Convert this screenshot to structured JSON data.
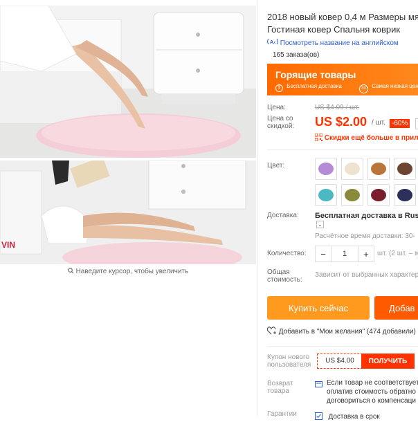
{
  "gallery": {
    "zoom_hint": "Наведите курсор, чтобы увеличить"
  },
  "product": {
    "title_line1": "2018 новый ковер 0,4 м Размеры мяг",
    "title_line2": "Гостиная ковер Спальня коврик",
    "translate_link": "Посмотреть название на английском",
    "orders": "165 заказа(ов)"
  },
  "hot_deals": {
    "title": "Горящие товары",
    "feature1": "Бесплатная доставка",
    "feature2": "Самая низкая цен",
    "badge1": "$",
    "badge2": "30"
  },
  "price": {
    "label": "Цена:",
    "old": "US $4.09 / шт.",
    "discount_label_line1": "Цена со",
    "discount_label_line2": "скидкой:",
    "new": "US $2.00",
    "per_unit": "/ шт.",
    "percent": "-60%",
    "app_discount": "Скидки ещё больше в прило"
  },
  "color": {
    "label": "Цвет:",
    "swatches": [
      {
        "name": "purple",
        "color": "#b58ad6"
      },
      {
        "name": "beige",
        "color": "#efe3cf"
      },
      {
        "name": "orange-brown",
        "color": "#b8763c"
      },
      {
        "name": "dark-brown",
        "color": "#6b4530"
      },
      {
        "name": "teal",
        "color": "#4cb8c4"
      },
      {
        "name": "olive",
        "color": "#8a8a3c"
      },
      {
        "name": "burgundy",
        "color": "#7a1e2e"
      },
      {
        "name": "navy",
        "color": "#2c2f5a"
      }
    ]
  },
  "shipping": {
    "label": "Доставка:",
    "method": "Бесплатная доставка в Russia",
    "time": "Расчётное время доставки: 30-"
  },
  "quantity": {
    "label": "Количество:",
    "value": "1",
    "note": "шт. (2 шт. – м"
  },
  "total": {
    "label_line1": "Общая",
    "label_line2": "стоимость:",
    "value": "Зависит от выбранных характер"
  },
  "actions": {
    "buy_now": "Купить сейчас",
    "add_to_cart": "Добав",
    "wishlist": "Добавить в \"Мои желания\" (474 добавили)"
  },
  "coupon": {
    "label_line1": "Купон нового",
    "label_line2": "пользователя",
    "value": "US $4.00",
    "button": "ПОЛУЧИТЬ"
  },
  "returns": {
    "label_line1": "Возврат",
    "label_line2": "товара",
    "line1": "Если товар не соответствует",
    "line2": "оплатив стоимость обратно",
    "line3": "договориться о компенсаци"
  },
  "guarantee": {
    "label": "Гарантии",
    "text": "Доставка в срок"
  },
  "colors": {
    "accent": "#ff3300",
    "buy_button": "#ff9a1f",
    "cart_button": "#ff5a00",
    "link": "#2a5bd7"
  }
}
